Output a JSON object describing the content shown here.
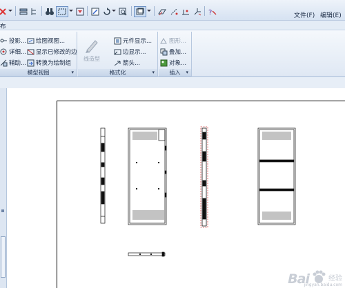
{
  "menu": {
    "file": "文件(F)",
    "edit": "编辑(E)"
  },
  "title_strip": "布",
  "ribbon": {
    "model_views": {
      "label": "模型视图",
      "items": [
        {
          "label": "投影..."
        },
        {
          "label": "详细..."
        },
        {
          "label": "辅助..."
        },
        {
          "label": "绘图视图..."
        },
        {
          "label": "显示已修改的边"
        },
        {
          "label": "转换为绘制组"
        }
      ]
    },
    "format": {
      "label": "格式化",
      "big_button": "线造型",
      "items": [
        {
          "label": "元件显示..."
        },
        {
          "label": "边显示..."
        },
        {
          "label": "箭头..."
        }
      ]
    },
    "insert": {
      "label": "插入",
      "items": [
        {
          "label": "图形..."
        },
        {
          "label": "叠加..."
        },
        {
          "label": "对象..."
        }
      ]
    }
  },
  "watermark": {
    "brand": "Bai",
    "brand2": "经验",
    "url": "jingyan.baidu.com"
  },
  "colors": {
    "ribbon_bg": "#dfe8f4",
    "canvas_bg": "#ffffff",
    "section_line": "#d94848"
  }
}
